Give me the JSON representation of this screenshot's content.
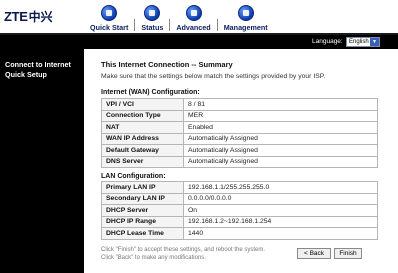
{
  "brand": {
    "logo_text": "ZTE",
    "logo_cn": "中兴"
  },
  "nav": [
    {
      "label": "Quick Start"
    },
    {
      "label": "Status"
    },
    {
      "label": "Advanced"
    },
    {
      "label": "Management"
    }
  ],
  "language": {
    "label": "Language:",
    "selected": "English"
  },
  "sidebar": {
    "title": "Connect to Internet Quick Setup"
  },
  "main": {
    "title": "This Internet Connection -- Summary",
    "intro": "Make sure that the settings below match the settings provided by your ISP.",
    "wan": {
      "title": "Internet (WAN) Configuration:",
      "rows": [
        {
          "key": "VPI / VCI",
          "value": "8 / 81"
        },
        {
          "key": "Connection Type",
          "value": "MER"
        },
        {
          "key": "NAT",
          "value": "Enabled"
        },
        {
          "key": "WAN IP Address",
          "value": "Automatically Assigned"
        },
        {
          "key": "Default Gateway",
          "value": "Automatically Assigned"
        },
        {
          "key": "DNS Server",
          "value": "Automatically Assigned"
        }
      ]
    },
    "lan": {
      "title": "LAN Configuration:",
      "rows": [
        {
          "key": "Primary LAN IP",
          "value": "192.168.1.1/255.255.255.0"
        },
        {
          "key": "Secondary LAN IP",
          "value": "0.0.0.0/0.0.0.0"
        },
        {
          "key": "DHCP Server",
          "value": "On"
        },
        {
          "key": "DHCP IP Range",
          "value": "192.168.1.2~192.168.1.254"
        },
        {
          "key": "DHCP Lease Time",
          "value": "1440"
        }
      ]
    },
    "footnote_1": "Click \"Finish\" to accept these settings, and reboot the system.",
    "footnote_2": "Click \"Back\" to make any modifications.",
    "back_label": "< Back",
    "finish_label": "Finish"
  }
}
